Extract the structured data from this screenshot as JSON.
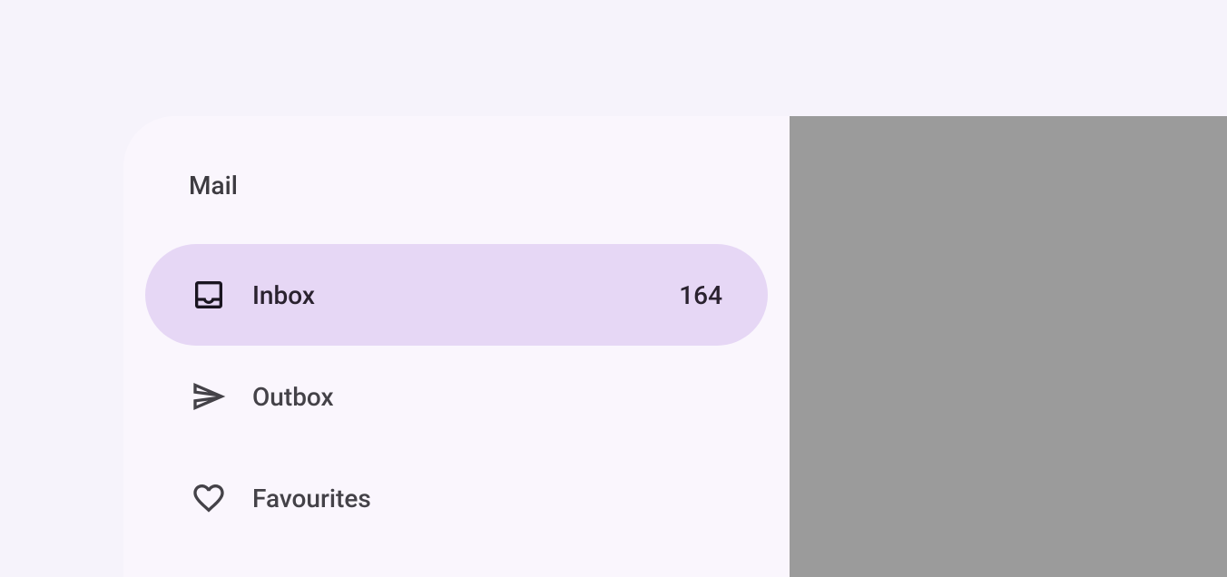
{
  "sidebar": {
    "title": "Mail",
    "items": [
      {
        "label": "Inbox",
        "badge": "164",
        "icon": "inbox-icon",
        "active": true
      },
      {
        "label": "Outbox",
        "badge": "",
        "icon": "send-icon",
        "active": false
      },
      {
        "label": "Favourites",
        "badge": "",
        "icon": "heart-icon",
        "active": false
      }
    ]
  }
}
